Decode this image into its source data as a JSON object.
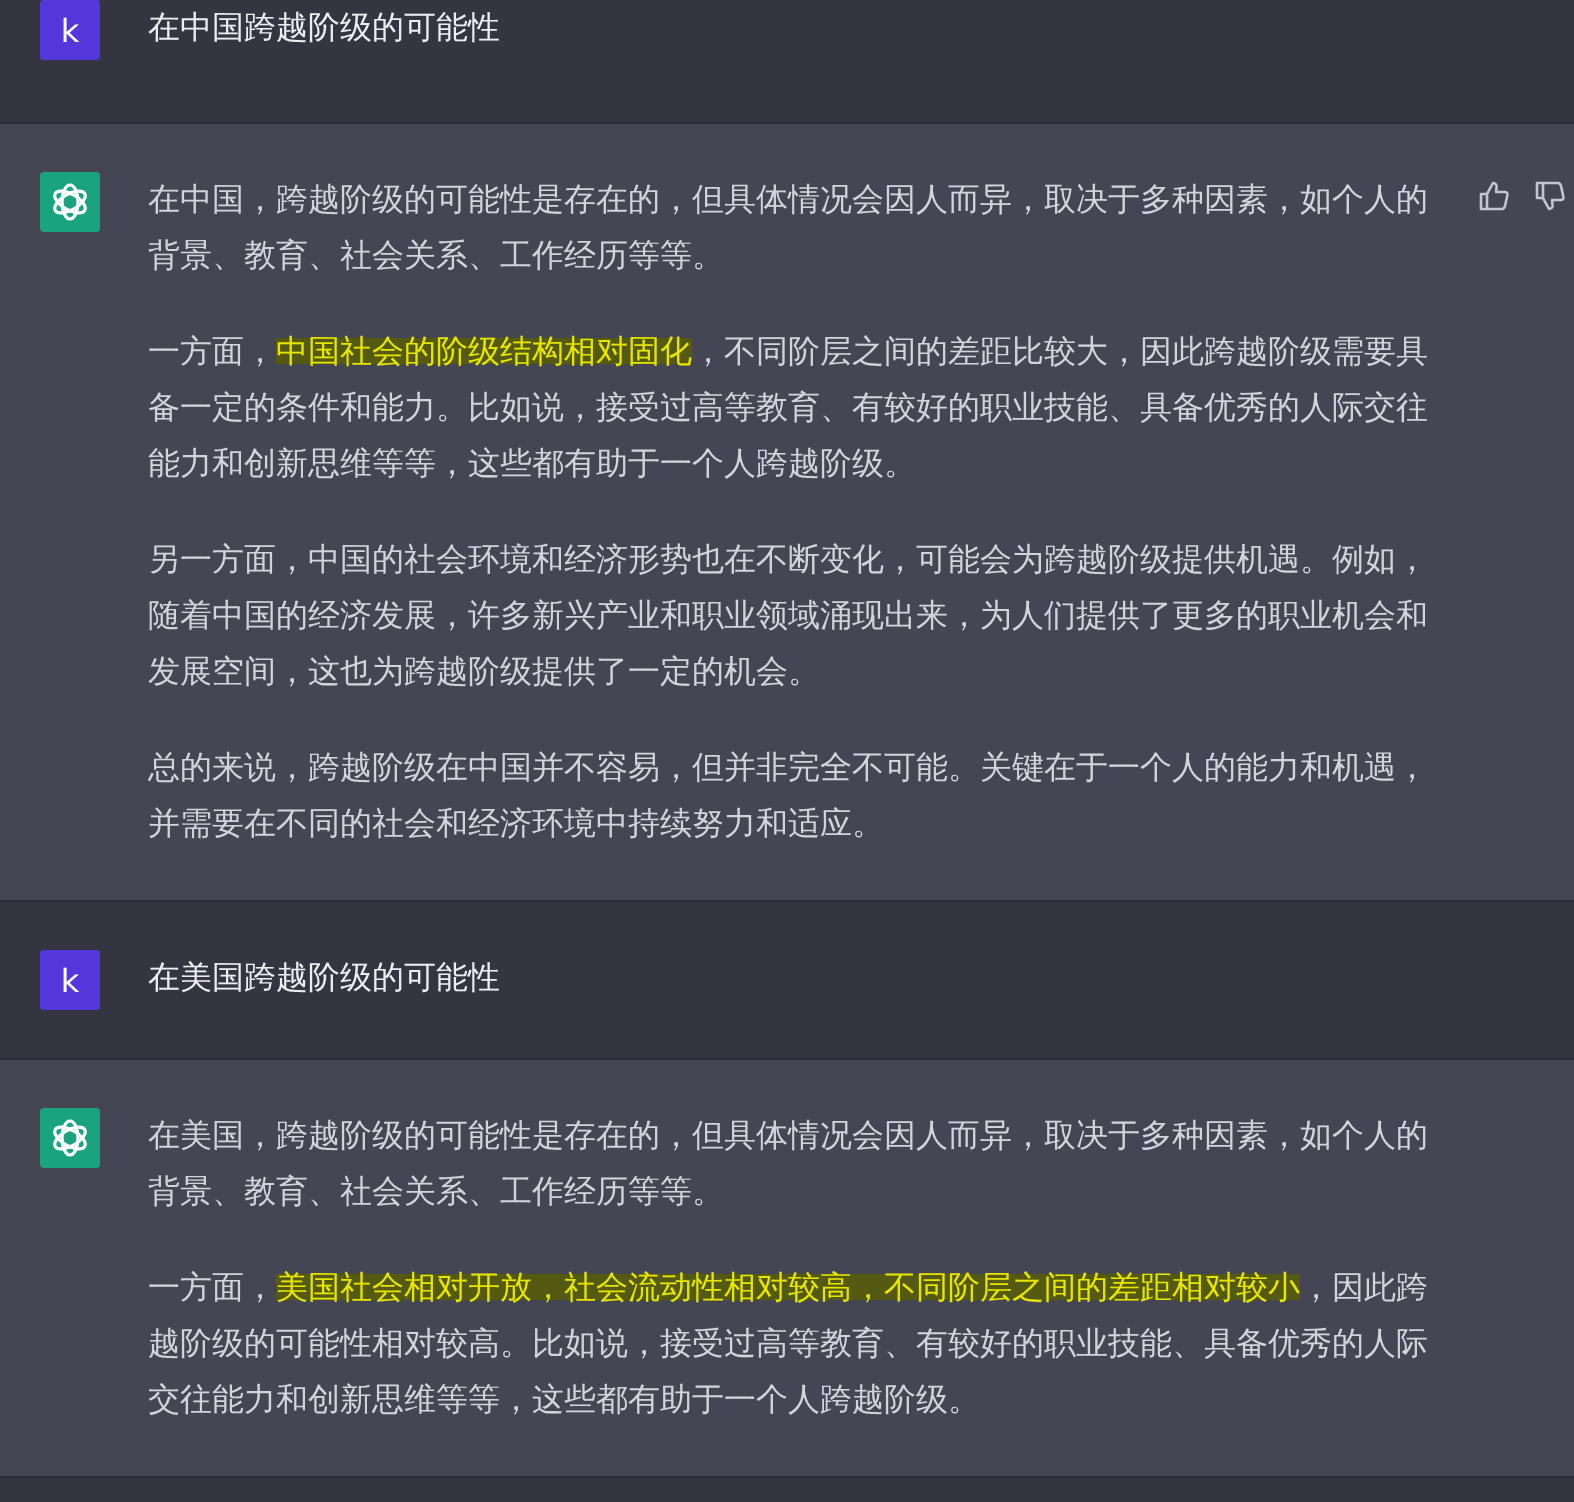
{
  "messages": [
    {
      "kind": "user",
      "avatar": "k",
      "paragraphs": [
        [
          {
            "text": "在中国跨越阶级的可能性",
            "highlighted": false
          }
        ]
      ]
    },
    {
      "kind": "assistant",
      "feedback": true,
      "paragraphs": [
        [
          {
            "text": "在中国，跨越阶级的可能性是存在的，但具体情况会因人而异，取决于多种因素，如个人的背景、教育、社会关系、工作经历等等。",
            "highlighted": false
          }
        ],
        [
          {
            "text": "一方面，",
            "highlighted": false
          },
          {
            "text": "中国社会的阶级结构相对固化",
            "highlighted": true
          },
          {
            "text": "，不同阶层之间的差距比较大，因此跨越阶级需要具备一定的条件和能力。比如说，接受过高等教育、有较好的职业技能、具备优秀的人际交往能力和创新思维等等，这些都有助于一个人跨越阶级。",
            "highlighted": false
          }
        ],
        [
          {
            "text": "另一方面，中国的社会环境和经济形势也在不断变化，可能会为跨越阶级提供机遇。例如，随着中国的经济发展，许多新兴产业和职业领域涌现出来，为人们提供了更多的职业机会和发展空间，这也为跨越阶级提供了一定的机会。",
            "highlighted": false
          }
        ],
        [
          {
            "text": "总的来说，跨越阶级在中国并不容易，但并非完全不可能。关键在于一个人的能力和机遇，并需要在不同的社会和经济环境中持续努力和适应。",
            "highlighted": false
          }
        ]
      ]
    },
    {
      "kind": "user",
      "avatar": "k",
      "paragraphs": [
        [
          {
            "text": "在美国跨越阶级的可能性",
            "highlighted": false
          }
        ]
      ]
    },
    {
      "kind": "assistant",
      "feedback": false,
      "paragraphs": [
        [
          {
            "text": "在美国，跨越阶级的可能性是存在的，但具体情况会因人而异，取决于多种因素，如个人的背景、教育、社会关系、工作经历等等。",
            "highlighted": false
          }
        ],
        [
          {
            "text": "一方面，",
            "highlighted": false
          },
          {
            "text": "美国社会相对开放，社会流动性相对较高，不同阶层之间的差距相对较小",
            "highlighted": true
          },
          {
            "text": "，因此跨越阶级的可能性相对较高。比如说，接受过高等教育、有较好的职业技能、具备优秀的人际交往能力和创新思维等等，这些都有助于一个人跨越阶级。",
            "highlighted": false
          }
        ]
      ]
    }
  ]
}
